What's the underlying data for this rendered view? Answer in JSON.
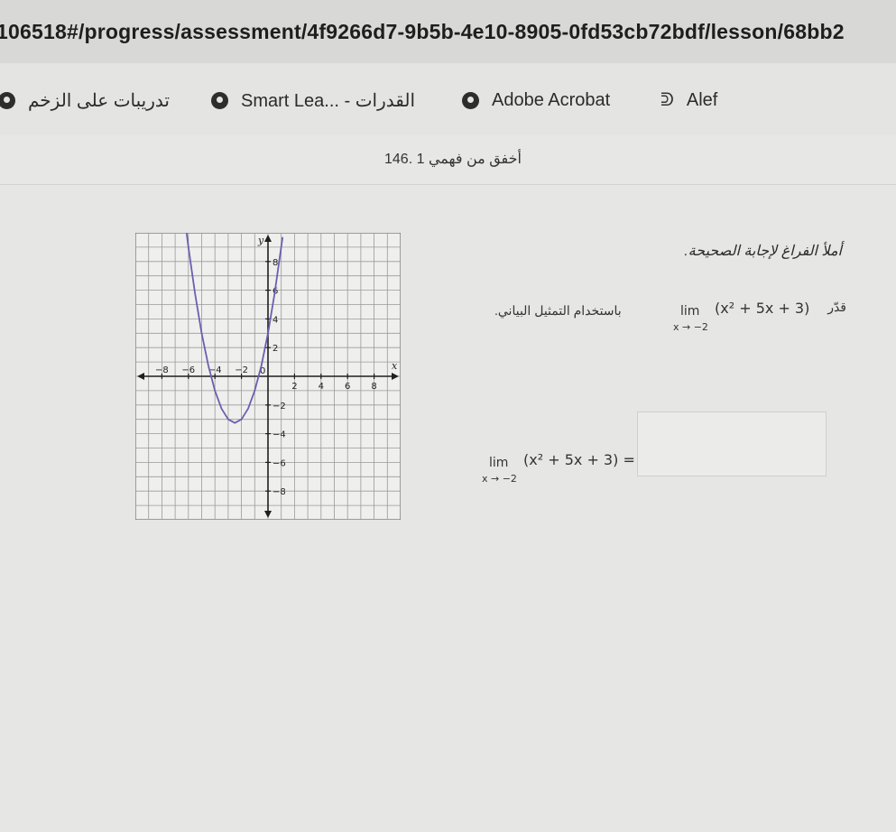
{
  "browser": {
    "url": "106518#/progress/assessment/4f9266d7-9b5b-4e10-8905-0fd53cb72bdf/lesson/68bb2"
  },
  "bookmarks": [
    {
      "label": "تدريبات على الزخم",
      "icon": "globe-icon"
    },
    {
      "label": "Smart Lea... - القدرات",
      "icon": "globe-icon"
    },
    {
      "label": "Adobe Acrobat",
      "icon": "globe-icon"
    },
    {
      "label": "Alef",
      "icon": "alef-icon"
    }
  ],
  "breadcrumb": "146. 1 أخفق من فهمي",
  "question": {
    "instruction": "أملأ الفراغ لإجابة الصحيحة.",
    "prompt_right": "قدّر",
    "prompt_left": "باستخدام التمثيل البياني.",
    "limit_label": "lim",
    "limit_sub": "x → −2",
    "limit_expr": "(x² + 5x + 3)",
    "answer_expr": "(x² + 5x + 3) =",
    "answer_value": ""
  },
  "chart_data": {
    "type": "line",
    "xlabel": "x",
    "ylabel": "y",
    "xlim": [
      -10,
      10
    ],
    "ylim": [
      -10,
      10
    ],
    "grid": true,
    "x_ticks": [
      -8,
      -6,
      -4,
      -2,
      2,
      4,
      6,
      8
    ],
    "y_ticks": [
      -8,
      -6,
      -4,
      -2,
      2,
      4,
      6,
      8
    ],
    "origin_label": "0",
    "function": "x^2 + 5x + 3",
    "series": [
      {
        "x": [
          -6.3,
          -6,
          -5.5,
          -5,
          -4.5,
          -4,
          -3.5,
          -3,
          -2.5,
          -2,
          -1.5,
          -1,
          -0.5,
          0,
          0.5,
          1.1
        ],
        "y": [
          11.2,
          9,
          5.75,
          3,
          0.75,
          -1,
          -2.25,
          -3,
          -3.25,
          -3,
          -2.25,
          -1,
          0.75,
          3,
          5.75,
          9.7
        ]
      }
    ]
  }
}
